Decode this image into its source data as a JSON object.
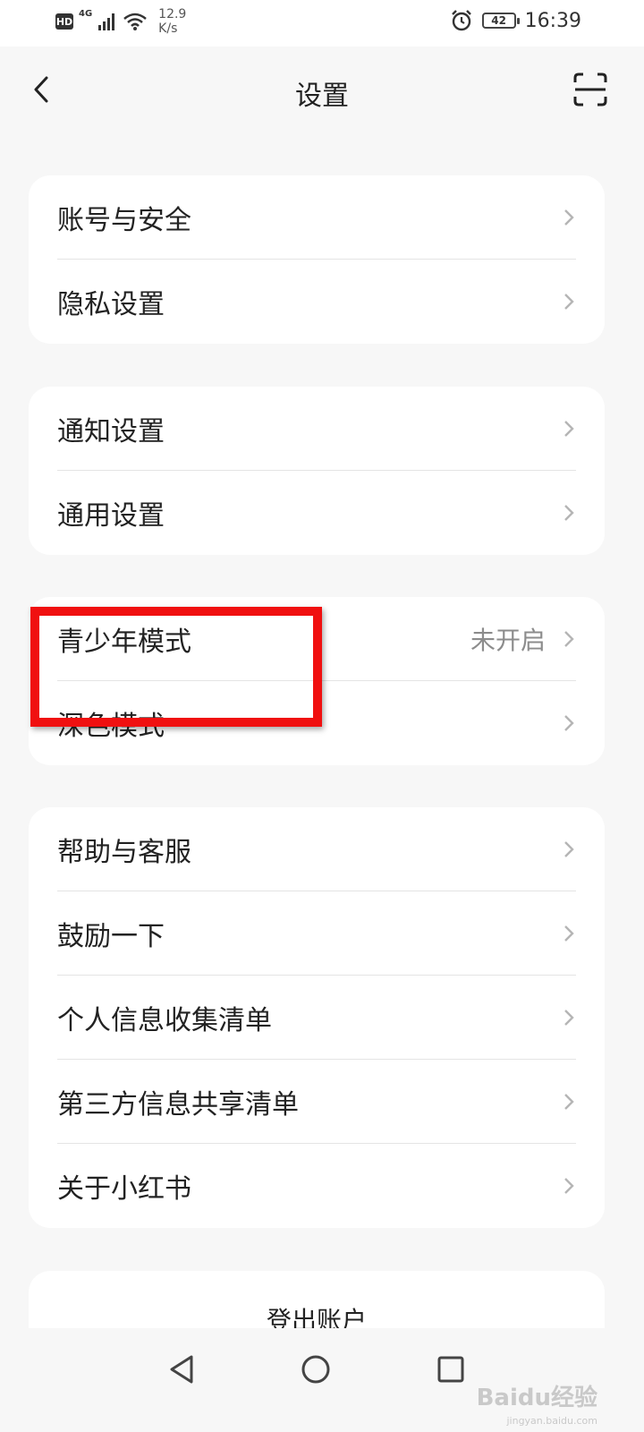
{
  "status_bar": {
    "hd": "HD",
    "network": "4G",
    "speed_value": "12.9",
    "speed_unit": "K/s",
    "battery": "42",
    "time": "16:39"
  },
  "nav": {
    "title": "设置"
  },
  "groups": [
    {
      "items": [
        {
          "label": "账号与安全"
        },
        {
          "label": "隐私设置"
        }
      ]
    },
    {
      "items": [
        {
          "label": "通知设置"
        },
        {
          "label": "通用设置"
        }
      ]
    },
    {
      "items": [
        {
          "label": "青少年模式",
          "value": "未开启"
        },
        {
          "label": "深色模式"
        }
      ]
    },
    {
      "items": [
        {
          "label": "帮助与客服"
        },
        {
          "label": "鼓励一下"
        },
        {
          "label": "个人信息收集清单"
        },
        {
          "label": "第三方信息共享清单"
        },
        {
          "label": "关于小红书"
        }
      ]
    }
  ],
  "logout": {
    "label": "登出账户"
  },
  "watermark": {
    "main": "Baidu经验",
    "sub": "jingyan.baidu.com"
  },
  "colors": {
    "highlight": "#f01010",
    "background": "#f7f7f7",
    "card": "#ffffff"
  }
}
